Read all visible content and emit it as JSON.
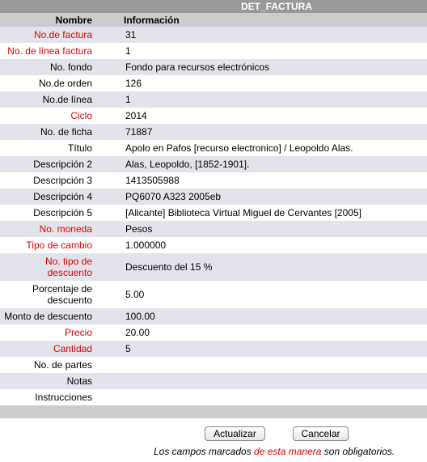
{
  "header": {
    "title": "DET_FACTURA"
  },
  "columns": {
    "label": "Nombre",
    "info": "Información"
  },
  "rows": [
    {
      "label": "No.de factura",
      "value": "31",
      "required": true
    },
    {
      "label": "No. de línea factura",
      "value": "1",
      "required": true
    },
    {
      "label": "No. fondo",
      "value": "Fondo para recursos electrónicos",
      "required": false
    },
    {
      "label": "No.de orden",
      "value": "126",
      "required": false
    },
    {
      "label": "No.de línea",
      "value": "1",
      "required": false
    },
    {
      "label": "Ciclo",
      "value": "2014",
      "required": true
    },
    {
      "label": "No. de ficha",
      "value": "71887",
      "required": false
    },
    {
      "label": "Título",
      "value": "Apolo en Pafos [recurso electronico] / Leopoldo Alas.",
      "required": false
    },
    {
      "label": "Descripción 2",
      "value": "Alas, Leopoldo, [1852-1901].",
      "required": false
    },
    {
      "label": "Descripción 3",
      "value": "1413505988",
      "required": false
    },
    {
      "label": "Descripción 4",
      "value": "PQ6070 A323 2005eb",
      "required": false
    },
    {
      "label": "Descripción 5",
      "value": "[Alicante] Biblioteca Virtual Miguel de Cervantes [2005]",
      "required": false
    },
    {
      "label": "No. moneda",
      "value": "Pesos",
      "required": true
    },
    {
      "label": "Tipo de cambio",
      "value": "1.000000",
      "required": true
    },
    {
      "label": "No. tipo de descuento",
      "value": "Descuento del 15 %",
      "required": true,
      "tall": true
    },
    {
      "label": "Porcentaje de descuento",
      "value": "5.00",
      "required": false,
      "tall": true
    },
    {
      "label": "Monto de descuento",
      "value": "100.00",
      "required": false
    },
    {
      "label": "Precio",
      "value": "20.00",
      "required": true
    },
    {
      "label": "Cantidad",
      "value": "5",
      "required": true
    },
    {
      "label": "No. de partes",
      "value": "",
      "required": false
    },
    {
      "label": "Notas",
      "value": "",
      "required": false
    },
    {
      "label": "Instrucciones",
      "value": "",
      "required": false
    }
  ],
  "actions": {
    "update_label": "Actualizar",
    "cancel_label": "Cancelar"
  },
  "note": {
    "before": "Los campos marcados ",
    "highlight": "de esta manera",
    "after": " son obligatorios."
  },
  "colors": {
    "required": "#e00000",
    "header_bg": "#999999",
    "row_alt": "#e3e3eb",
    "column_header_bg": "#cccccc"
  }
}
